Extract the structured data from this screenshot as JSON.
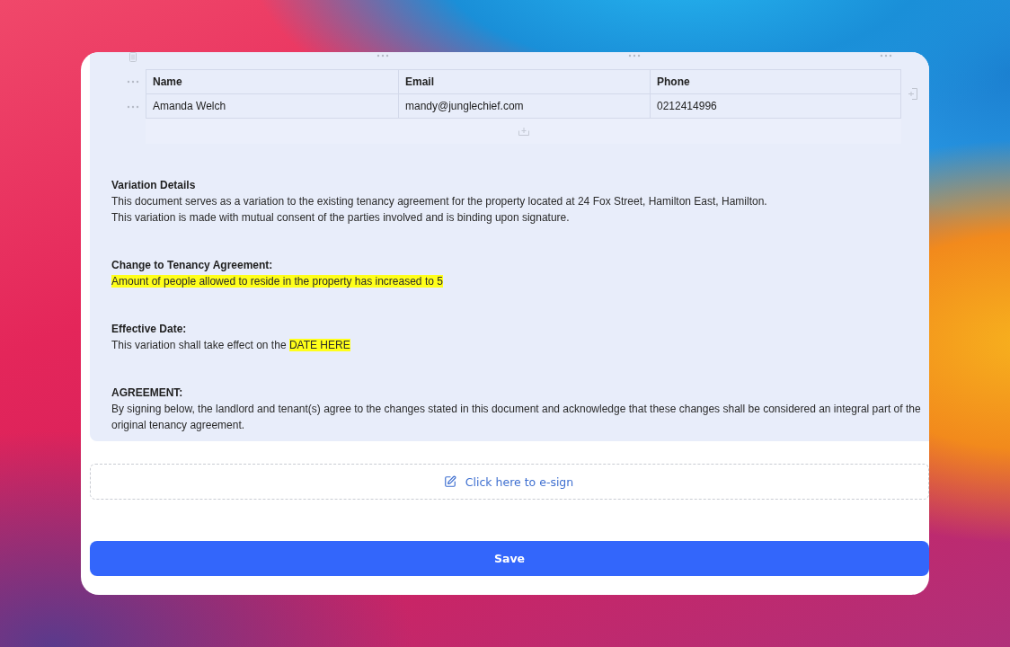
{
  "table": {
    "columns": [
      {
        "label": "Name"
      },
      {
        "label": "Email"
      },
      {
        "label": "Phone"
      }
    ],
    "rows": [
      {
        "cells": [
          "Amanda Welch",
          "mandy@junglechief.com",
          "0212414996"
        ]
      }
    ]
  },
  "sections": [
    {
      "heading": "Variation Details",
      "paragraphs": [
        {
          "segments": [
            {
              "text": "This document serves as a variation to the existing tenancy agreement for the property located at 24 Fox Street, Hamilton East, Hamilton.",
              "highlighted": false
            }
          ]
        },
        {
          "segments": [
            {
              "text": "This variation is made with mutual consent of the parties involved and is binding upon signature.",
              "highlighted": false
            }
          ]
        }
      ]
    },
    {
      "heading": "Change to Tenancy Agreement:",
      "paragraphs": [
        {
          "segments": [
            {
              "text": "Amount of people allowed to reside in the property has increased to 5",
              "highlighted": true
            }
          ]
        }
      ]
    },
    {
      "heading": "Effective Date:",
      "paragraphs": [
        {
          "segments": [
            {
              "text": "This variation shall take effect on the ",
              "highlighted": false
            },
            {
              "text": "DATE HERE",
              "highlighted": true
            }
          ]
        }
      ]
    },
    {
      "heading": "AGREEMENT:",
      "paragraphs": [
        {
          "segments": [
            {
              "text": "By signing below, the landlord and tenant(s) agree to the changes stated in this document and acknowledge that these changes shall be considered an integral part of the original tenancy agreement.",
              "highlighted": false
            }
          ]
        }
      ]
    }
  ],
  "esign": {
    "label": "Click here to e-sign"
  },
  "save_button": {
    "label": "Save"
  }
}
